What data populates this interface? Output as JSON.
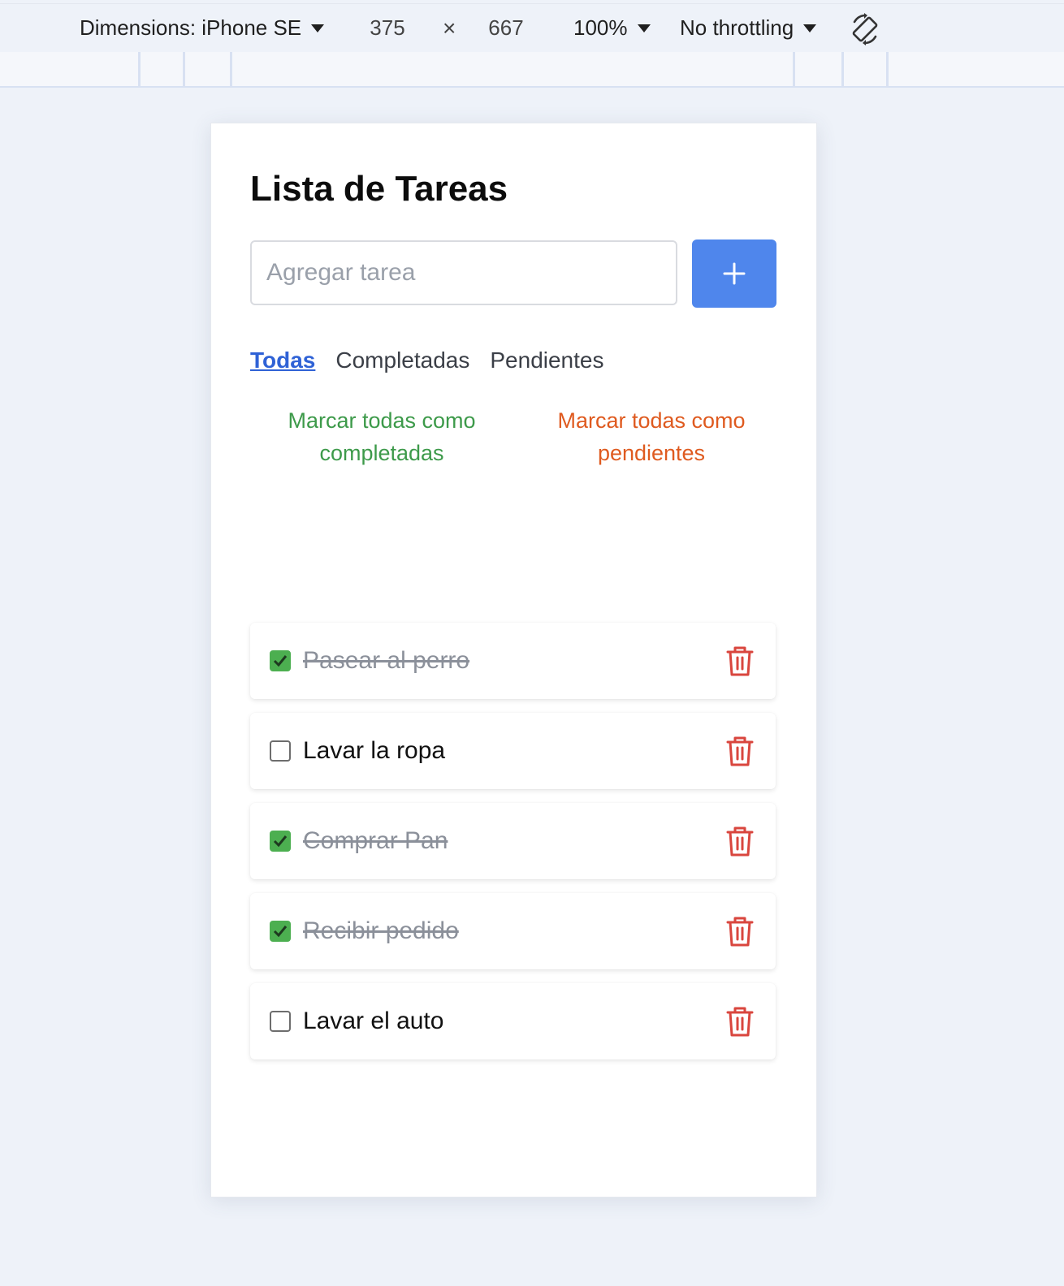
{
  "devtools": {
    "dimensions_label": "Dimensions: iPhone SE",
    "width": "375",
    "times": "×",
    "height": "667",
    "zoom": "100%",
    "throttling": "No throttling",
    "rotate_icon": "rotate-icon"
  },
  "app": {
    "title": "Lista de Tareas",
    "input_placeholder": "Agregar tarea",
    "add_icon": "plus-icon",
    "tabs": [
      {
        "label": "Todas",
        "active": true
      },
      {
        "label": "Completadas",
        "active": false
      },
      {
        "label": "Pendientes",
        "active": false
      }
    ],
    "mark_all_completed": "Marcar todas como completadas",
    "mark_all_pending": "Marcar todas como pendientes",
    "tasks": [
      {
        "text": "Pasear al perro",
        "done": true
      },
      {
        "text": "Lavar la ropa",
        "done": false
      },
      {
        "text": "Comprar Pan",
        "done": true
      },
      {
        "text": "Recibir pedido",
        "done": true
      },
      {
        "text": "Lavar el auto",
        "done": false
      }
    ],
    "delete_icon": "trash-icon"
  },
  "colors": {
    "accent": "#4f86ec",
    "tab_active": "#2f62d6",
    "complete": "#3d9a4a",
    "pending": "#df5a1f",
    "delete": "#d9463e",
    "checkbox_on": "#4caf50"
  }
}
